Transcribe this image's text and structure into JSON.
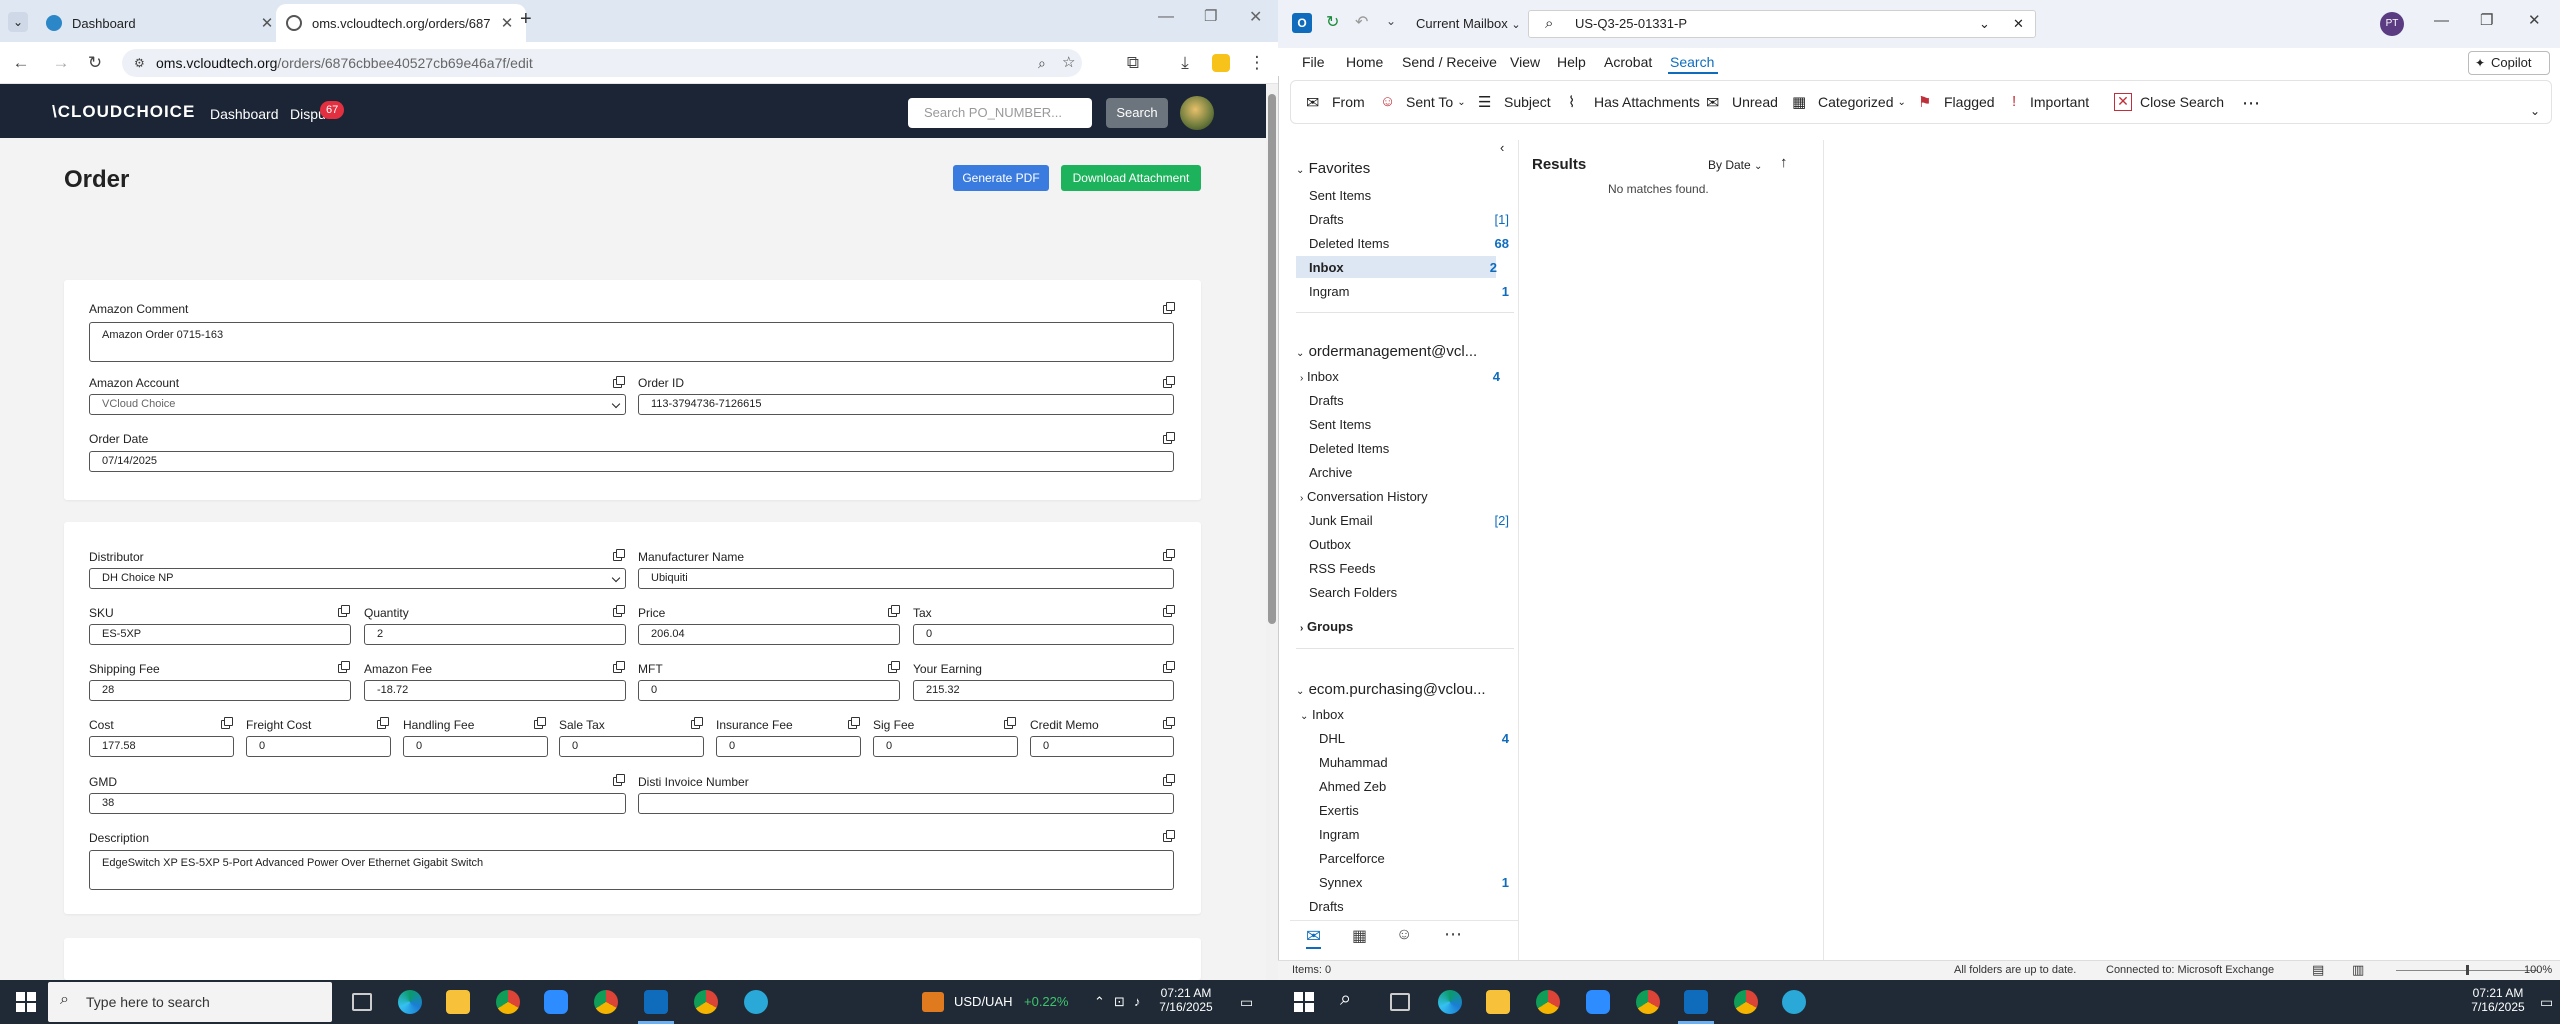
{
  "browser": {
    "tabs": [
      {
        "title": "Dashboard",
        "active": false
      },
      {
        "title": "oms.vcloudtech.org/orders/687",
        "active": true
      }
    ],
    "url_host": "oms.vcloudtech.org",
    "url_path": "/orders/6876cbbee40527cb69e46a7f/edit"
  },
  "app": {
    "logo": "\\CLOUDCHOICE",
    "nav_dashboard": "Dashboard",
    "nav_disputes": "Dispu",
    "disputes_count": "67",
    "search_placeholder": "Search PO_NUMBER...",
    "search_button": "Search"
  },
  "page": {
    "title": "Order",
    "generate_pdf": "Generate PDF",
    "download_attachment": "Download Attachment"
  },
  "card1": {
    "amazon_comment_label": "Amazon Comment",
    "amazon_comment": "Amazon Order 0715-163",
    "amazon_account_label": "Amazon Account",
    "amazon_account": "VCloud Choice",
    "order_id_label": "Order ID",
    "order_id": "113-3794736-7126615",
    "order_date_label": "Order Date",
    "order_date": "07/14/2025"
  },
  "card2": {
    "distributor_label": "Distributor",
    "distributor": "DH Choice NP",
    "manufacturer_label": "Manufacturer Name",
    "manufacturer": "Ubiquiti",
    "sku_label": "SKU",
    "sku": "ES-5XP",
    "quantity_label": "Quantity",
    "quantity": "2",
    "price_label": "Price",
    "price": "206.04",
    "tax_label": "Tax",
    "tax": "0",
    "shipping_label": "Shipping Fee",
    "shipping": "28",
    "amazon_fee_label": "Amazon Fee",
    "amazon_fee": "-18.72",
    "mft_label": "MFT",
    "mft": "0",
    "earning_label": "Your Earning",
    "earning": "215.32",
    "cost_label": "Cost",
    "cost": "177.58",
    "freight_label": "Freight Cost",
    "freight": "0",
    "handling_label": "Handling Fee",
    "handling": "0",
    "sales_tax_label": "Sale Tax",
    "sales_tax": "0",
    "insurance_label": "Insurance Fee",
    "insurance": "0",
    "sig_label": "Sig Fee",
    "sig": "0",
    "credit_label": "Credit Memo",
    "credit": "0",
    "gmd_label": "GMD",
    "gmd": "38",
    "disti_invoice_label": "Disti Invoice Number",
    "disti_invoice": "",
    "description_label": "Description",
    "description": "EdgeSwitch XP ES-5XP 5-Port Advanced Power Over Ethernet Gigabit Switch"
  },
  "outlook": {
    "mailbox_scope": "Current Mailbox",
    "search_query": "US-Q3-25-01331-P",
    "avatar": "PT",
    "menu": [
      "File",
      "Home",
      "Send / Receive",
      "View",
      "Help",
      "Acrobat",
      "Search"
    ],
    "copilot": "Copilot",
    "ribbon": [
      "From",
      "Sent To",
      "Subject",
      "Has Attachments",
      "Unread",
      "Categorized",
      "Flagged",
      "Important",
      "Close Search"
    ],
    "favorites_header": "Favorites",
    "favorites": [
      {
        "name": "Sent Items",
        "count": ""
      },
      {
        "name": "Drafts",
        "count": "[1]"
      },
      {
        "name": "Deleted Items",
        "count": "68"
      },
      {
        "name": "Inbox",
        "count": "2"
      },
      {
        "name": "Ingram",
        "count": "1"
      }
    ],
    "account1_header": "ordermanagement@vcl...",
    "account1_folders": [
      {
        "name": "Inbox",
        "count": "4"
      },
      {
        "name": "Drafts",
        "count": ""
      },
      {
        "name": "Sent Items",
        "count": ""
      },
      {
        "name": "Deleted Items",
        "count": ""
      },
      {
        "name": "Archive",
        "count": ""
      },
      {
        "name": "Conversation History",
        "count": ""
      },
      {
        "name": "Junk Email",
        "count": "[2]"
      },
      {
        "name": "Outbox",
        "count": ""
      },
      {
        "name": "RSS Feeds",
        "count": ""
      },
      {
        "name": "Search Folders",
        "count": ""
      }
    ],
    "groups_header": "Groups",
    "account2_header": "ecom.purchasing@vclou...",
    "account2_inbox": "Inbox",
    "account2_subfolders": [
      {
        "name": "DHL",
        "count": "4"
      },
      {
        "name": "Muhammad",
        "count": ""
      },
      {
        "name": "Ahmed Zeb",
        "count": ""
      },
      {
        "name": "Exertis",
        "count": ""
      },
      {
        "name": "Ingram",
        "count": ""
      },
      {
        "name": "Parcelforce",
        "count": ""
      },
      {
        "name": "Synnex",
        "count": "1"
      }
    ],
    "account2_drafts": "Drafts",
    "results_label": "Results",
    "sort_label": "By Date",
    "no_matches": "No matches found.",
    "status_items": "Items: 0",
    "status_sync": "All folders are up to date.",
    "status_connection": "Connected to: Microsoft Exchange",
    "zoom": "100%"
  },
  "taskbar": {
    "search_placeholder": "Type here to search",
    "ticker": "USD/UAH",
    "ticker_change": "+0.22%",
    "time": "07:21 AM",
    "date": "7/16/2025"
  }
}
